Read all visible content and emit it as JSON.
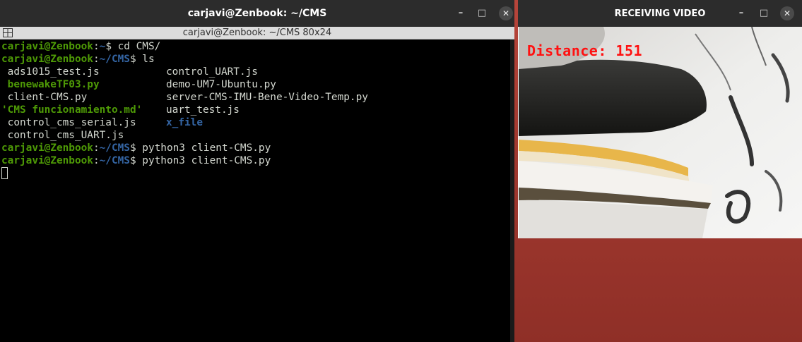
{
  "terminal": {
    "window_title": "carjavi@Zenbook: ~/CMS",
    "tab_title": "carjavi@Zenbook: ~/CMS 80x24",
    "lines": [
      {
        "user": "carjavi@Zenbook",
        "sep": ":",
        "path": "~",
        "prompt": "$ ",
        "cmd": "cd CMS/"
      },
      {
        "user": "carjavi@Zenbook",
        "sep": ":",
        "path": "~/CMS",
        "prompt": "$ ",
        "cmd": "ls"
      }
    ],
    "ls_rows": [
      {
        "c1": " ads1015_test.js",
        "c1_class": "",
        "c2": "control_UART.js",
        "c2_class": ""
      },
      {
        "c1": " benewakeTF03.py",
        "c1_class": "exec",
        "c2": "demo-UM7-Ubuntu.py",
        "c2_class": ""
      },
      {
        "c1": " client-CMS.py",
        "c1_class": "",
        "c2": "server-CMS-IMU-Bene-Video-Temp.py",
        "c2_class": ""
      },
      {
        "c1": "'CMS funcionamiento.md'",
        "c1_class": "exec",
        "c2": "uart_test.js",
        "c2_class": ""
      },
      {
        "c1": " control_cms_serial.js",
        "c1_class": "",
        "c2": "x_file",
        "c2_class": "dir"
      },
      {
        "c1": " control_cms_UART.js",
        "c1_class": "",
        "c2": "",
        "c2_class": ""
      }
    ],
    "after_lines": [
      {
        "user": "carjavi@Zenbook",
        "sep": ":",
        "path": "~/CMS",
        "prompt": "$ ",
        "cmd": "python3 client-CMS.py"
      },
      {
        "user": "carjavi@Zenbook",
        "sep": ":",
        "path": "~/CMS",
        "prompt": "$ ",
        "cmd": "python3 client-CMS.py"
      }
    ],
    "buttons": {
      "minimize": "–",
      "maximize": "□",
      "close": "✕"
    }
  },
  "video": {
    "window_title": "RECEIVING VIDEO",
    "overlay_text": "Distance: 151",
    "buttons": {
      "minimize": "–",
      "maximize": "□",
      "close": "✕"
    }
  },
  "colors": {
    "prompt_user": "#4e9a06",
    "prompt_path": "#3465a4",
    "overlay": "#ff1111",
    "desktop": "#a33a30"
  }
}
